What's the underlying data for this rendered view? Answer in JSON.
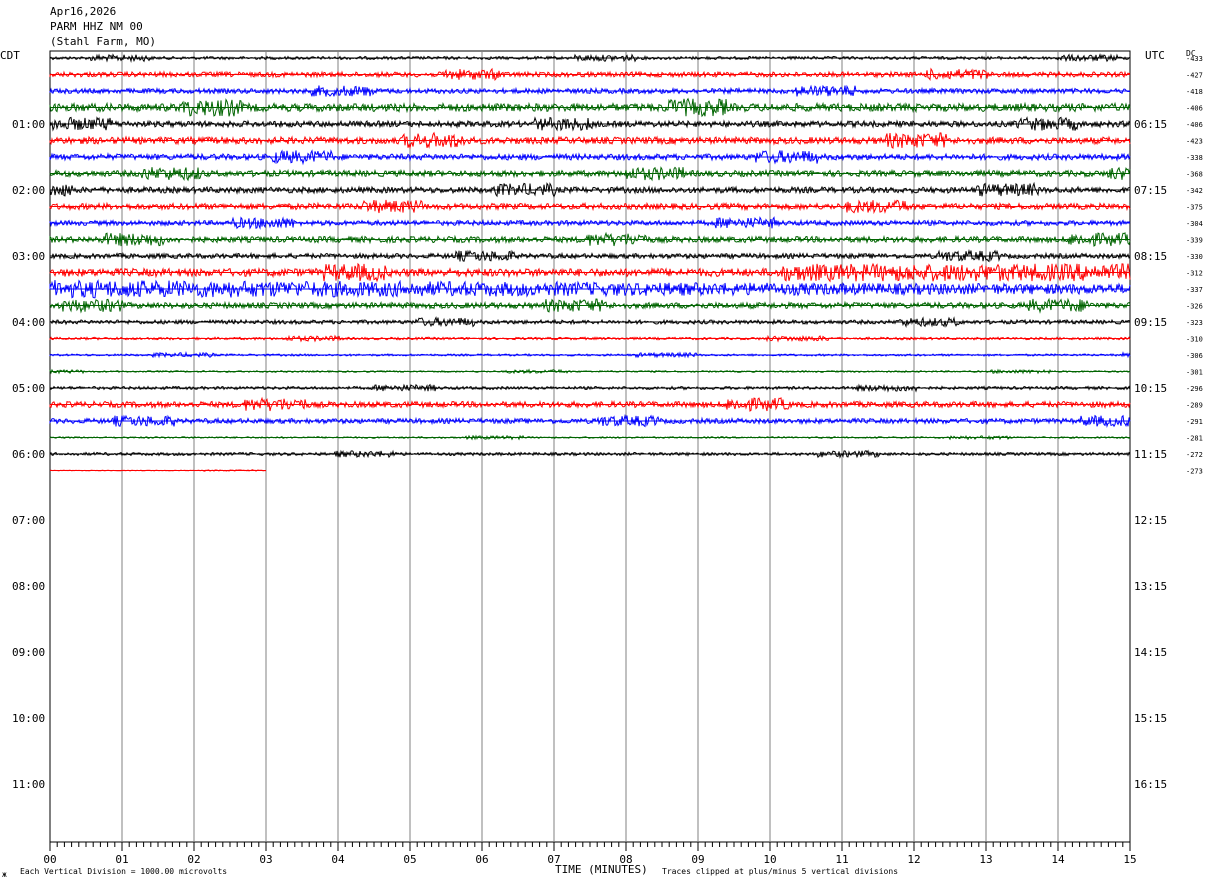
{
  "header": {
    "date": "Apr16,2026",
    "station": "PARM HHZ NM 00",
    "location": "(Stahl Farm, MO)"
  },
  "left_tz": "CDT",
  "right_tz": "UTC",
  "dc_label": "DC",
  "footer": {
    "scale_note": "Each Vertical Division = 1000.00 microvolts",
    "clip_note": "Traces clipped at plus/minus 5 vertical divisions",
    "corner_mark": "ж"
  },
  "colors": {
    "trace_cycle": [
      "#000000",
      "#ff0000",
      "#0000ff",
      "#006400"
    ],
    "grid": "#808080"
  },
  "chart_data": {
    "type": "line",
    "title": "PARM HHZ NM 00",
    "xlabel": "TIME (MINUTES)",
    "ylabel": "",
    "xlim": [
      0,
      15
    ],
    "x_tick_labels": [
      "00",
      "01",
      "02",
      "03",
      "04",
      "05",
      "06",
      "07",
      "08",
      "09",
      "10",
      "11",
      "12",
      "13",
      "14",
      "15"
    ],
    "left_time_labels": [
      "01:00",
      "02:00",
      "03:00",
      "04:00",
      "05:00",
      "06:00",
      "07:00",
      "08:00",
      "09:00",
      "10:00",
      "11:00"
    ],
    "right_time_labels": [
      "06:15",
      "07:15",
      "08:15",
      "09:15",
      "10:15",
      "11:15",
      "12:15",
      "13:15",
      "14:15",
      "15:15",
      "16:15"
    ],
    "dc_offsets": [
      -433,
      -427,
      -418,
      -406,
      -406,
      -423,
      -338,
      -368,
      -342,
      -375,
      -304,
      -339,
      -330,
      -312,
      -337,
      -326,
      -323,
      -310,
      -306,
      -301,
      -296,
      -289,
      -291,
      -281,
      -272,
      -273
    ],
    "trace_amplitude": [
      1.5,
      2.5,
      2.5,
      4,
      3,
      3.5,
      3,
      3,
      3,
      3,
      2.5,
      3,
      2.5,
      4,
      7,
      3,
      2,
      1.2,
      1,
      0.8,
      1.5,
      3,
      2.5,
      0.8,
      1.5,
      0.3
    ],
    "trace_end_minute": [
      15,
      15,
      15,
      15,
      15,
      15,
      15,
      15,
      15,
      15,
      15,
      15,
      15,
      15,
      15,
      15,
      15,
      15,
      15,
      15,
      15,
      15,
      15,
      15,
      15,
      3
    ],
    "grid": true
  }
}
